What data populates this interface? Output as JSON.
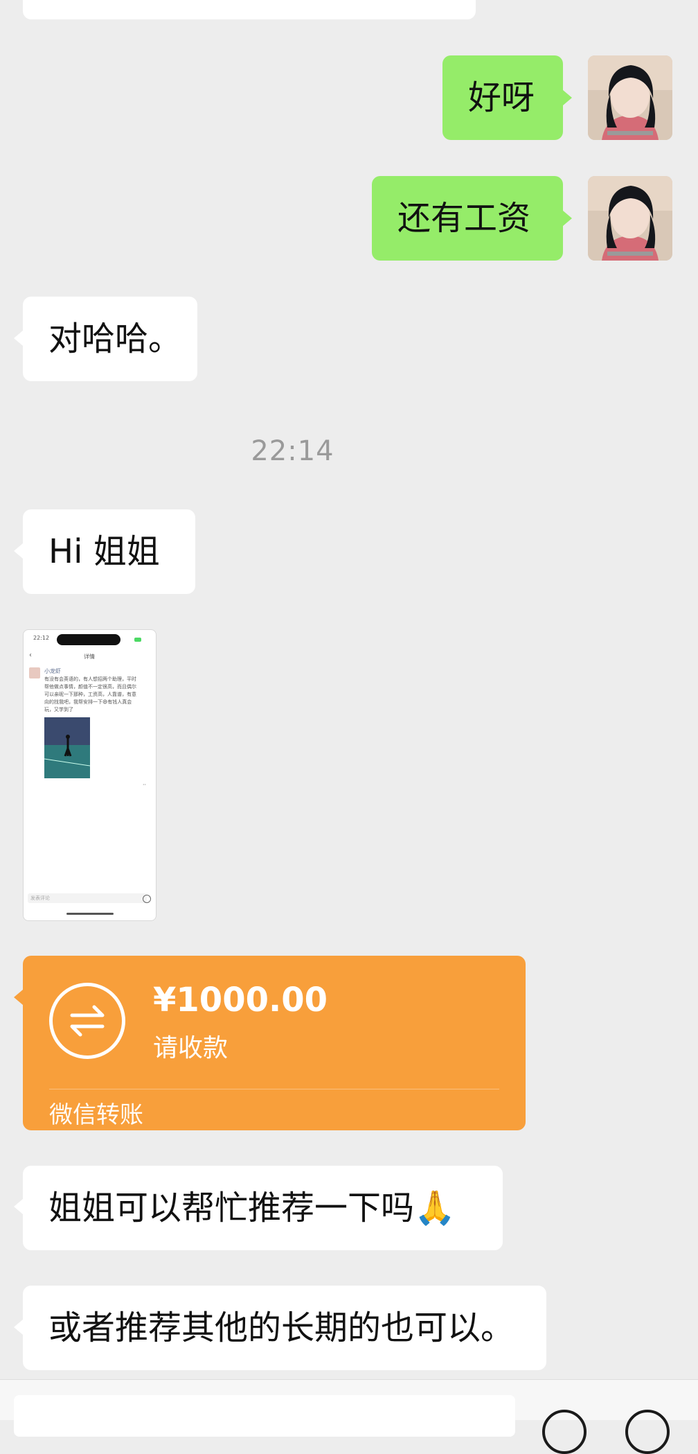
{
  "messages": {
    "right_1": "好呀",
    "right_2": "还有工资",
    "left_1": "对哈哈。",
    "timestamp": "22:14",
    "left_2": "Hi 姐姐",
    "left_3": "姐姐可以帮忙推荐一下吗🙏",
    "left_4": "或者推荐其他的长期的也可以。"
  },
  "thumbnail": {
    "status_time": "22:12",
    "header": "详情",
    "user": "小龙虾",
    "post_lines": [
      "有没有会英语的，有人想招两个助理，平时",
      "帮他做点事情，颜值不一定很高，而且偶尔",
      "可以亲昵一下那种，工资高，人靠谱，有意",
      "向的找我吧，我帮安排一下😄有钱人真会",
      "玩，又学到了"
    ],
    "comment_placeholder": "发表评论"
  },
  "transfer": {
    "amount": "¥1000.00",
    "status": "请收款",
    "footer": "微信转账"
  },
  "icons": {
    "transfer": "transfer-arrows-icon",
    "voice": "voice-icon",
    "emoji": "emoji-icon"
  },
  "colors": {
    "chat_bg": "#ededed",
    "self_bubble": "#95ec69",
    "other_bubble": "#ffffff",
    "transfer_card": "#f89f3b"
  }
}
